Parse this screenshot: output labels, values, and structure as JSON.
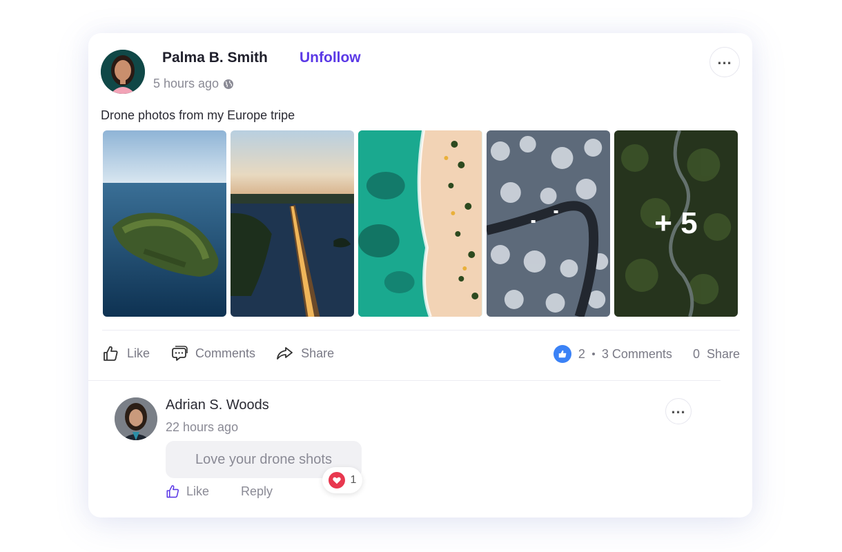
{
  "post": {
    "author": "Palma B. Smith",
    "follow_label": "Unfollow",
    "time": "5 hours ago",
    "caption": "Drone photos from my Europe tripe",
    "photos": [
      "island",
      "highway",
      "beach",
      "snowy-road",
      "forest-road"
    ],
    "more_count": "+ 5",
    "actions": {
      "like": "Like",
      "comments": "Comments",
      "share": "Share"
    },
    "stats": {
      "likes": "2",
      "comments": "3 Comments",
      "shares_count": "0",
      "shares_label": "Share"
    }
  },
  "comment": {
    "author": "Adrian S. Woods",
    "time": "22 hours ago",
    "text": "Love your drone shots",
    "reaction_count": "1",
    "like": "Like",
    "reply": "Reply"
  },
  "colors": {
    "accent": "#5b39e6",
    "like_blue": "#3b82f6",
    "heart_red": "#e8384f"
  }
}
